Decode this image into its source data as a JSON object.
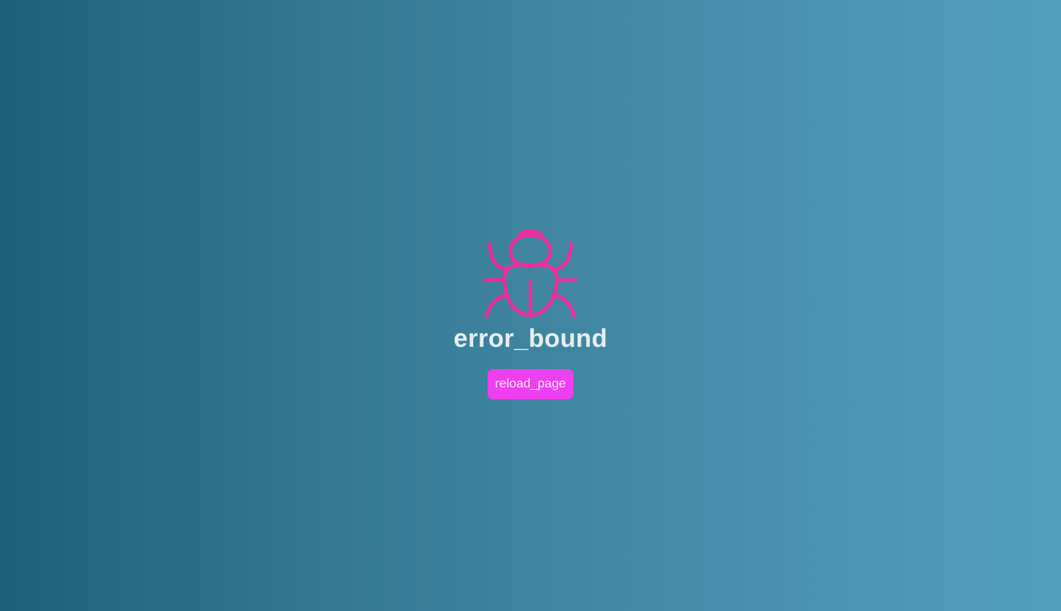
{
  "error": {
    "icon": "bug-icon",
    "title": "error_bound",
    "action_label": "reload_page"
  },
  "colors": {
    "background_start": "#1f6079",
    "background_end": "#529fbe",
    "icon": "#f02c9a",
    "title": "#e6edf0",
    "button": "#ee3ff0",
    "button_text": "#fde9fd"
  }
}
